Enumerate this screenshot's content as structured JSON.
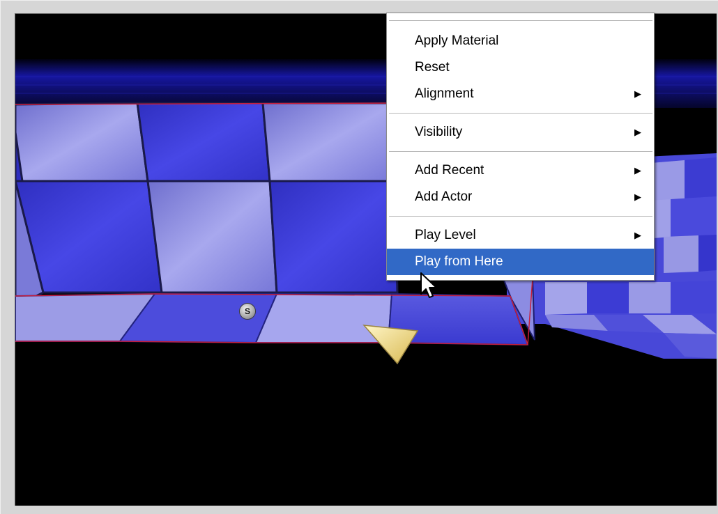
{
  "viewport": {
    "spawn_marker_label": "S"
  },
  "context_menu": {
    "groups": [
      [
        {
          "label": "Apply Material",
          "submenu": false
        },
        {
          "label": "Reset",
          "submenu": false
        },
        {
          "label": "Alignment",
          "submenu": true
        }
      ],
      [
        {
          "label": "Visibility",
          "submenu": true
        }
      ],
      [
        {
          "label": "Add Recent",
          "submenu": true
        },
        {
          "label": "Add Actor",
          "submenu": true
        }
      ],
      [
        {
          "label": "Play Level",
          "submenu": true
        },
        {
          "label": "Play from Here",
          "submenu": false,
          "highlighted": true
        }
      ]
    ],
    "submenu_arrow": "▶",
    "highlight_color": "#3169c6"
  },
  "colors": {
    "tile_dark": "#3b3bd6",
    "tile_light": "#8e8ee6",
    "viewport_bg": "#000000",
    "camera_marker": "#f3df8c"
  }
}
